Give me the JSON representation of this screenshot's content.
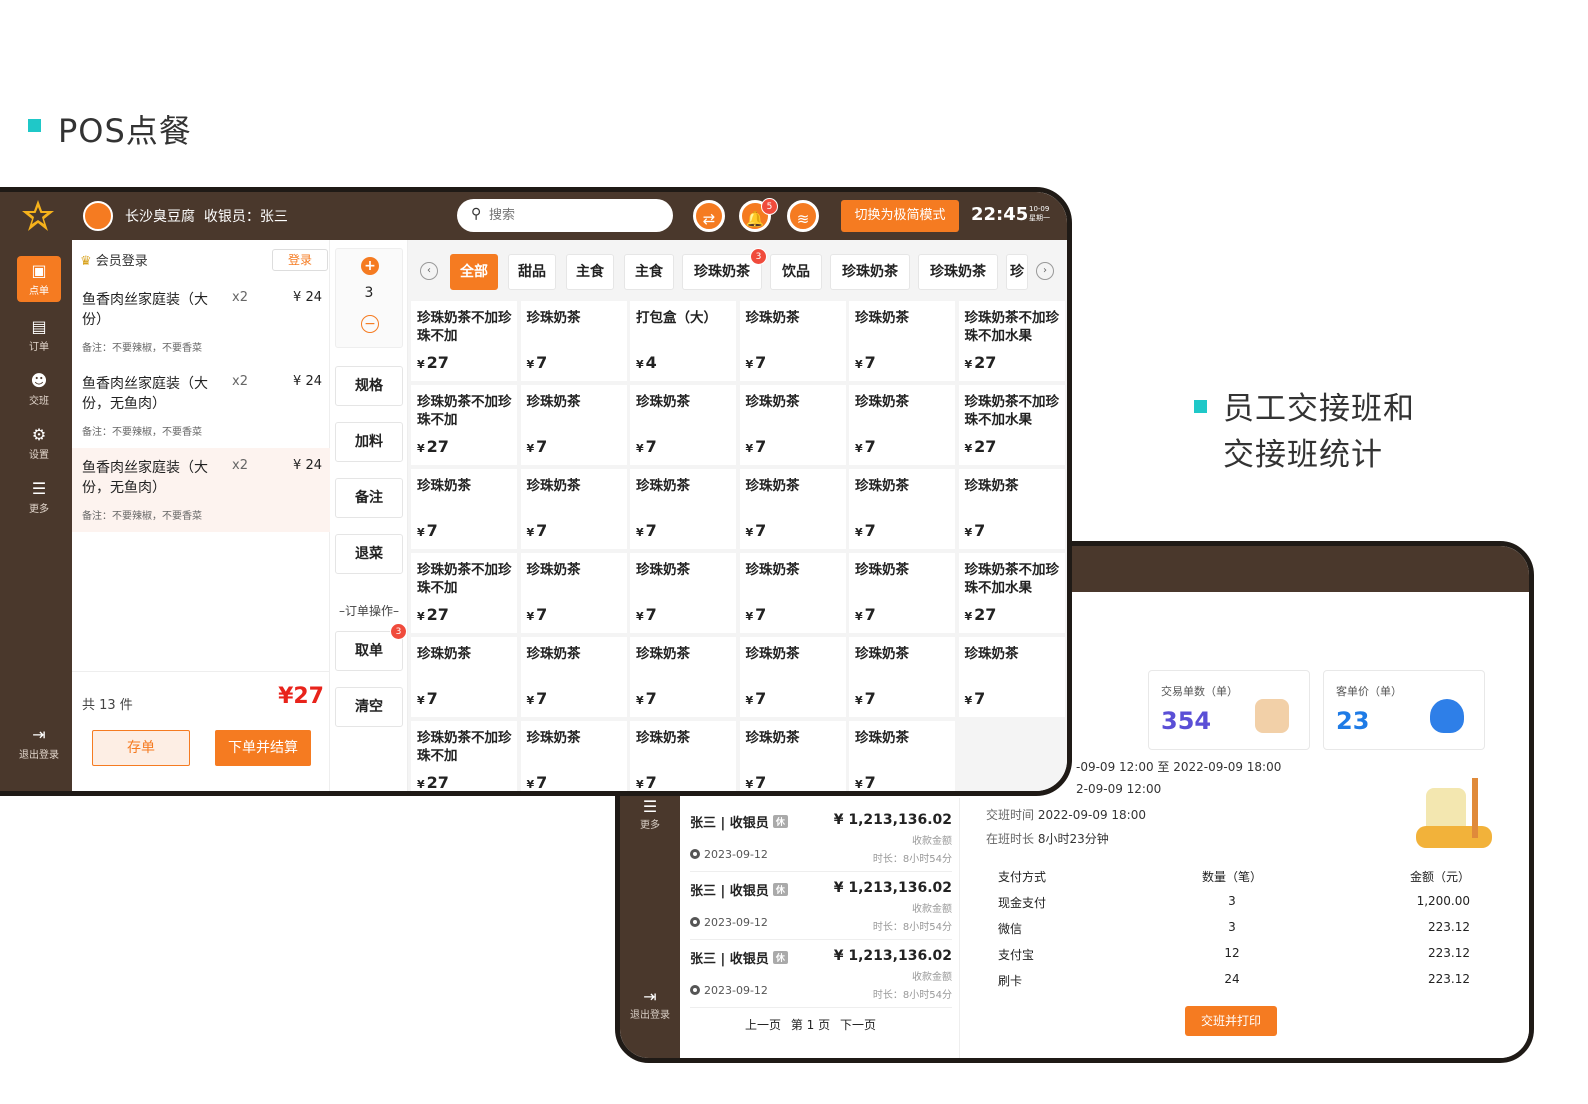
{
  "headings": {
    "pos": "POS点餐",
    "shift_line1": "员工交接班和",
    "shift_line2": "交接班统计"
  },
  "pos": {
    "shop_name": "长沙臭豆腐",
    "cashier": "收银员：张三",
    "search_placeholder": "搜索",
    "notification_count": "5",
    "mode_button": "切换为极简模式",
    "time": "22:45",
    "date": "10-09",
    "weekday": "星期一",
    "nav": [
      {
        "icon": "order-icon",
        "label": "点单",
        "active": true
      },
      {
        "icon": "receipt-icon",
        "label": "订单",
        "active": false
      },
      {
        "icon": "handover-icon",
        "label": "交班",
        "active": false
      },
      {
        "icon": "gear-icon",
        "label": "设置",
        "active": false
      },
      {
        "icon": "more-icon",
        "label": "更多",
        "active": false
      }
    ],
    "logout": "退出登录",
    "member_login": "会员登录",
    "login_button": "登录",
    "order_items": [
      {
        "name": "鱼香肉丝家庭装（大份）",
        "qty": "x2",
        "price": "¥ 24",
        "note": "备注：不要辣椒，不要香菜"
      },
      {
        "name": "鱼香肉丝家庭装（大份，无鱼肉）",
        "qty": "x2",
        "price": "¥ 24",
        "note": "备注：不要辣椒，不要香菜"
      },
      {
        "name": "鱼香肉丝家庭装（大份，无鱼肉）",
        "qty": "x2",
        "price": "¥ 24",
        "note": "备注：不要辣椒，不要香菜"
      }
    ],
    "total_count": "共 13 件",
    "total_price": "¥27",
    "save_button": "存单",
    "checkout_button": "下单并结算",
    "quantity": "3",
    "ops": {
      "spec": "规格",
      "addon": "加料",
      "note": "备注",
      "refund": "退菜",
      "section": "–订单操作–",
      "take": "取单",
      "take_badge": "3",
      "clear": "清空"
    },
    "categories": [
      "全部",
      "甜品",
      "主食",
      "主食",
      "珍珠奶茶",
      "饮品",
      "珍珠奶茶",
      "珍珠奶茶",
      "珍"
    ],
    "category_badge": "3",
    "dishes": [
      [
        [
          "珍珠奶茶不加珍珠不加",
          "27"
        ],
        [
          "珍珠奶茶",
          "7"
        ],
        [
          "打包盒（大）",
          "4"
        ],
        [
          "珍珠奶茶",
          "7"
        ],
        [
          "珍珠奶茶",
          "7"
        ],
        [
          "珍珠奶茶不加珍珠不加水果",
          "27"
        ]
      ],
      [
        [
          "珍珠奶茶不加珍珠不加",
          "27"
        ],
        [
          "珍珠奶茶",
          "7"
        ],
        [
          "珍珠奶茶",
          "7"
        ],
        [
          "珍珠奶茶",
          "7"
        ],
        [
          "珍珠奶茶",
          "7"
        ],
        [
          "珍珠奶茶不加珍珠不加水果",
          "27"
        ]
      ],
      [
        [
          "珍珠奶茶",
          "7"
        ],
        [
          "珍珠奶茶",
          "7"
        ],
        [
          "珍珠奶茶",
          "7"
        ],
        [
          "珍珠奶茶",
          "7"
        ],
        [
          "珍珠奶茶",
          "7"
        ],
        [
          "珍珠奶茶",
          "7"
        ]
      ],
      [
        [
          "珍珠奶茶不加珍珠不加",
          "27"
        ],
        [
          "珍珠奶茶",
          "7"
        ],
        [
          "珍珠奶茶",
          "7"
        ],
        [
          "珍珠奶茶",
          "7"
        ],
        [
          "珍珠奶茶",
          "7"
        ],
        [
          "珍珠奶茶不加珍珠不加水果",
          "27"
        ]
      ],
      [
        [
          "珍珠奶茶",
          "7"
        ],
        [
          "珍珠奶茶",
          "7"
        ],
        [
          "珍珠奶茶",
          "7"
        ],
        [
          "珍珠奶茶",
          "7"
        ],
        [
          "珍珠奶茶",
          "7"
        ],
        [
          "珍珠奶茶",
          "7"
        ]
      ],
      [
        [
          "珍珠奶茶不加珍珠不加",
          "27"
        ],
        [
          "珍珠奶茶",
          "7"
        ],
        [
          "珍珠奶茶",
          "7"
        ],
        [
          "珍珠奶茶",
          "7"
        ],
        [
          "珍珠奶茶",
          "7"
        ]
      ]
    ],
    "currency": "¥"
  },
  "shift": {
    "nav_more": "更多",
    "logout": "退出登录",
    "records": [
      {
        "name": "张三 | 收银员",
        "tag": "休",
        "amount": "¥ 1,213,136.02",
        "amount_label": "收款金额",
        "date": "2023-09-12",
        "duration": "时长：8小时54分"
      },
      {
        "name": "张三 | 收银员",
        "tag": "休",
        "amount": "¥ 1,213,136.02",
        "amount_label": "收款金额",
        "date": "2023-09-12",
        "duration": "时长：8小时54分"
      },
      {
        "name": "张三 | 收银员",
        "tag": "休",
        "amount": "¥ 1,213,136.02",
        "amount_label": "收款金额",
        "date": "2023-09-12",
        "duration": "时长：8小时54分"
      }
    ],
    "pager": {
      "prev": "上一页",
      "current": "第 1 页",
      "next": "下一页"
    },
    "cards": [
      {
        "title": "交易单数（单）",
        "value": "354",
        "color": "#5a4fd6"
      },
      {
        "title": "客单价（单）",
        "value": "23",
        "color": "#1e7be6"
      }
    ],
    "info": {
      "range": "-09-09 12:00 至 2022-09-09 18:00",
      "start": "2-09-09 12:00",
      "handover_label": "交班时间",
      "handover_time": "2022-09-09 18:00",
      "duration_label": "在班时长",
      "duration": "8小时23分钟"
    },
    "payment_header": [
      "支付方式",
      "数量（笔）",
      "金额（元）"
    ],
    "payments": [
      [
        "现金支付",
        "3",
        "1,200.00"
      ],
      [
        "微信",
        "3",
        "223.12"
      ],
      [
        "支付宝",
        "12",
        "223.12"
      ],
      [
        "刷卡",
        "24",
        "223.12"
      ]
    ],
    "print_button": "交班并打印"
  },
  "colors": {
    "accent": "#f57b21",
    "sidebar": "#4a382c",
    "teal": "#1fc8c8",
    "price_red": "#e8231b"
  }
}
